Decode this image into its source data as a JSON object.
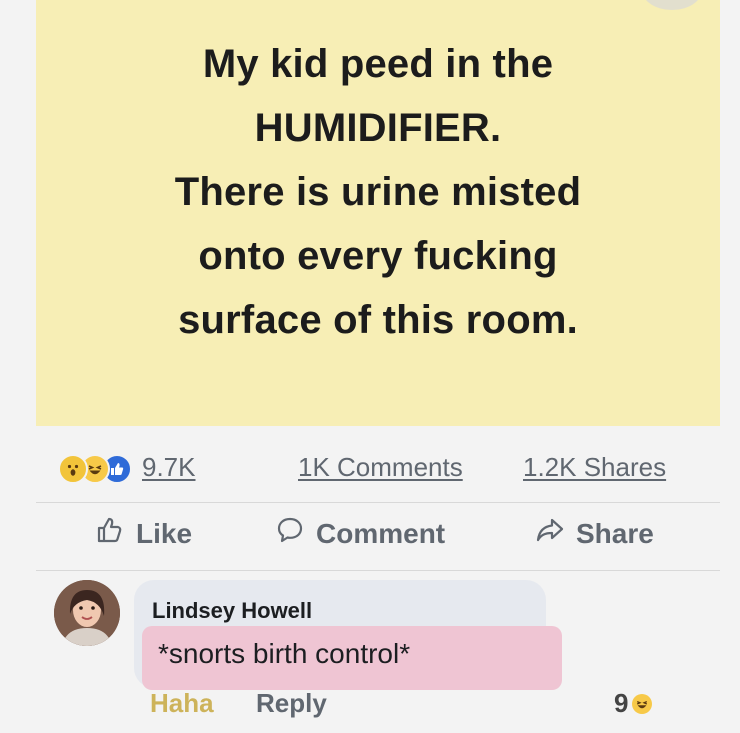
{
  "post": {
    "lines": [
      "My kid peed in the",
      "HUMIDIFIER.",
      "There is urine misted",
      "onto every fucking",
      "surface of this room."
    ],
    "background_color": "#f7eeb5"
  },
  "stats": {
    "reaction_icons": [
      "wow-icon",
      "haha-icon",
      "like-icon"
    ],
    "reaction_count": "9.7K",
    "comments": "1K Comments",
    "shares": "1.2K Shares"
  },
  "actions": {
    "like_label": "Like",
    "comment_label": "Comment",
    "share_label": "Share"
  },
  "comment": {
    "author": "Lindsey Howell",
    "text": "*snorts birth control*",
    "highlight_color": "#efc5d3",
    "reaction_label": "Haha",
    "reply_label": "Reply",
    "reaction_count": "9",
    "reaction_icon": "haha-icon"
  }
}
